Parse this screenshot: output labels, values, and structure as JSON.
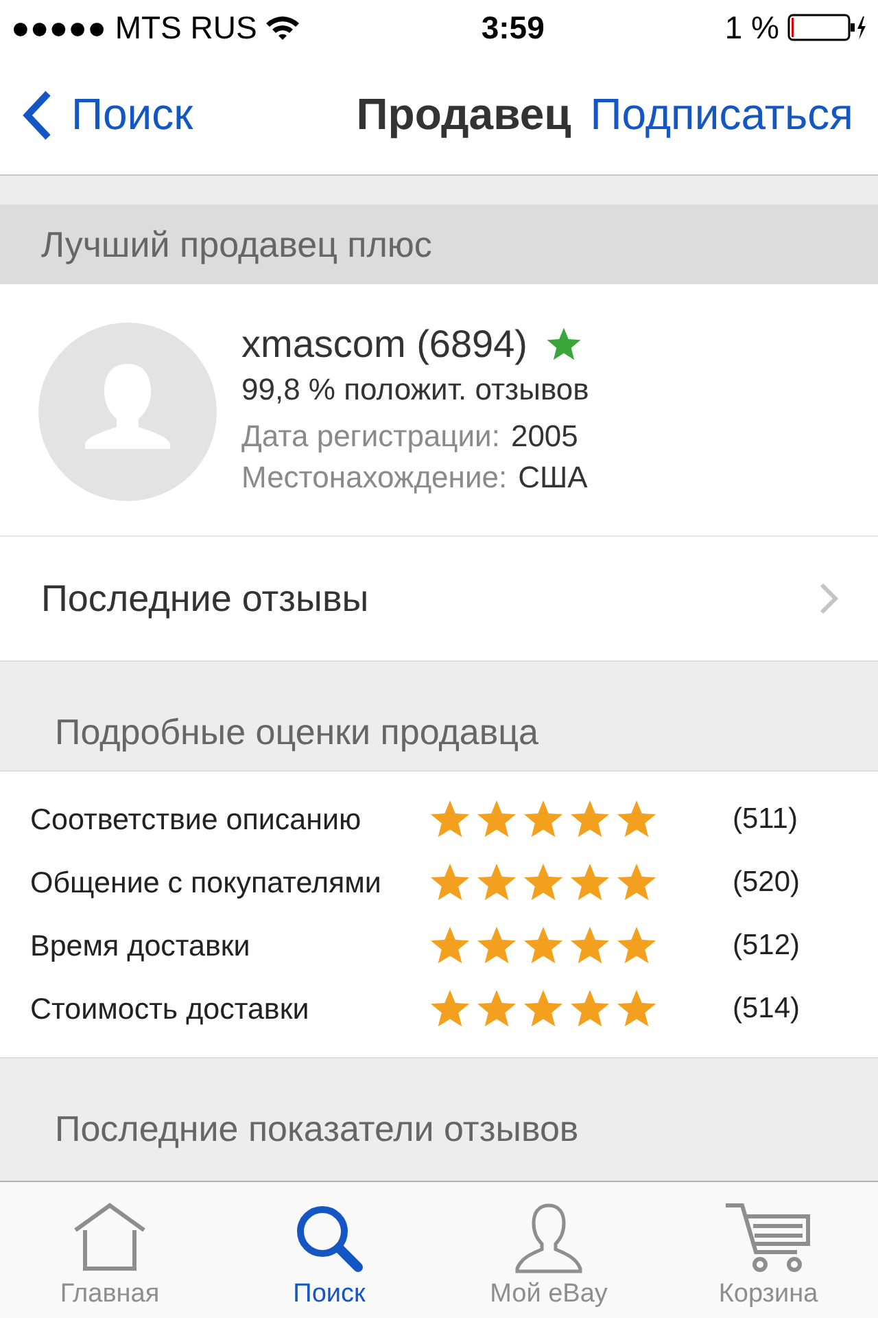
{
  "status_bar": {
    "carrier": "●●●●● MTS RUS",
    "time": "3:59",
    "battery": "1 %"
  },
  "nav": {
    "back": "Поиск",
    "title": "Продавец",
    "action": "Подписаться"
  },
  "seller_section": {
    "title": "Лучший продавец плюс"
  },
  "seller": {
    "name": "xmascom (6894)",
    "feedback": "99,8 % положит. отзывов",
    "registered": "Дата регистрации:",
    "registered_value": "2005",
    "location": "Местонахождение:",
    "location_value": "США"
  },
  "recent_feedback": {
    "label": "Последние отзывы"
  },
  "ratings_section": {
    "title": "Подробные оценки продавца"
  },
  "ratings": [
    {
      "label": "Соответствие описанию",
      "stars": 5,
      "count": "(511)"
    },
    {
      "label": "Общение с покупателями",
      "stars": 5,
      "count": "(520)"
    },
    {
      "label": "Время доставки",
      "stars": 5,
      "count": "(512)"
    },
    {
      "label": "Стоимость доставки",
      "stars": 5,
      "count": "(514)"
    }
  ],
  "stats_section": {
    "title": "Последние показатели отзывов"
  },
  "tab_bar": [
    {
      "kind": "home",
      "label": "Главная",
      "selected": false
    },
    {
      "kind": "search",
      "label": "Поиск",
      "selected": true
    },
    {
      "kind": "person",
      "label": "Мой eBay",
      "selected": false
    },
    {
      "kind": "cart",
      "label": "Корзина",
      "selected": false
    }
  ]
}
